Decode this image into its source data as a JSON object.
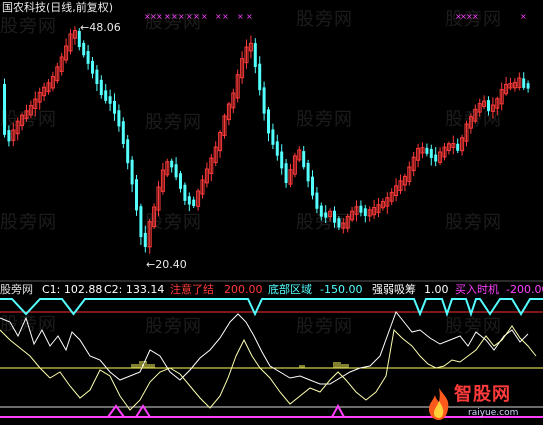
{
  "watermark": "股旁网",
  "price_panel": {
    "title": "国农科技(日线,前复权)",
    "high_label": "48.06",
    "low_label": "20.40",
    "high_arrow": "←",
    "low_arrow": "←"
  },
  "indicator_panel": {
    "name": "股旁网",
    "c1": "C1: 102.88",
    "c2": "C2: 133.14",
    "attention_label": "注意了结",
    "attention_value": "200.00",
    "bottom_label": "底部区域",
    "bottom_value": "-150.00",
    "absorb_label": "强弱吸筹",
    "absorb_value": "1.00",
    "buy_label": "买入时机",
    "buy_value": "-200.00"
  },
  "logo": {
    "text": "智股网",
    "url": "raiyue.com"
  },
  "colors": {
    "up": "#ff3a3a",
    "down": "#54ffff",
    "white": "#ffffff",
    "yellow": "#ffff60",
    "magenta": "#ff40ff",
    "red_line": "#ff3030"
  }
}
